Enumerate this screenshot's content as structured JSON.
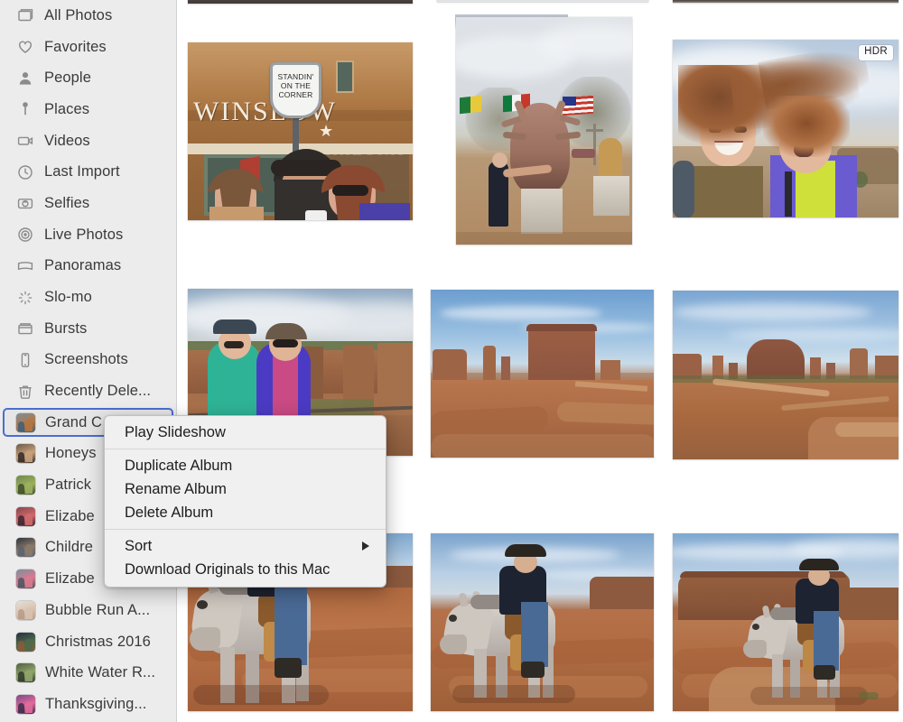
{
  "app": {
    "name": "Photos",
    "platform": "macOS"
  },
  "sidebar": {
    "background": "#ececec",
    "selection_border": "#4a6ed0",
    "smart_albums": [
      {
        "label": "All Photos",
        "icon": "all-photos-icon"
      },
      {
        "label": "Favorites",
        "icon": "heart-icon"
      },
      {
        "label": "People",
        "icon": "person-icon"
      },
      {
        "label": "Places",
        "icon": "map-pin-icon"
      },
      {
        "label": "Videos",
        "icon": "video-camera-icon"
      },
      {
        "label": "Last Import",
        "icon": "clock-icon"
      },
      {
        "label": "Selfies",
        "icon": "camera-icon"
      },
      {
        "label": "Live Photos",
        "icon": "live-photo-icon"
      },
      {
        "label": "Panoramas",
        "icon": "panorama-icon"
      },
      {
        "label": "Slo-mo",
        "icon": "slomo-icon"
      },
      {
        "label": "Bursts",
        "icon": "bursts-icon"
      },
      {
        "label": "Screenshots",
        "icon": "phone-icon"
      },
      {
        "label": "Recently Dele...",
        "icon": "trash-icon"
      }
    ],
    "albums": [
      {
        "label": "Grand C",
        "thumb": "album-thumb-grand-canyon",
        "selected": true,
        "colors": [
          "#7a8fa3",
          "#b5763f",
          "#3c5f7a"
        ]
      },
      {
        "label": "Honeys",
        "thumb": "album-thumb-honeymoon",
        "selected": false,
        "colors": [
          "#6b5a4a",
          "#c8a07a",
          "#2f2a26"
        ]
      },
      {
        "label": "Patrick",
        "thumb": "album-thumb-patrick",
        "selected": false,
        "colors": [
          "#6f8a4a",
          "#9bb05e",
          "#3f4d28"
        ]
      },
      {
        "label": "Elizabe",
        "thumb": "album-thumb-elizabeth-1",
        "selected": false,
        "colors": [
          "#8a4450",
          "#cf6a6a",
          "#3a2430"
        ]
      },
      {
        "label": "Childre",
        "thumb": "album-thumb-children",
        "selected": false,
        "colors": [
          "#2e3440",
          "#8a7a68",
          "#5a6272"
        ]
      },
      {
        "label": "Elizabe",
        "thumb": "album-thumb-elizabeth-2",
        "selected": false,
        "colors": [
          "#7d8f9e",
          "#d97a8f",
          "#4a5560"
        ]
      },
      {
        "label": "Bubble Run A...",
        "thumb": "album-thumb-bubble-run",
        "selected": false,
        "colors": [
          "#e6ded6",
          "#d7c2b0",
          "#b79b86"
        ]
      },
      {
        "label": "Christmas 2016",
        "thumb": "album-thumb-christmas-2016",
        "selected": false,
        "colors": [
          "#243040",
          "#4f6a4a",
          "#8a5a3a"
        ]
      },
      {
        "label": "White Water R...",
        "thumb": "album-thumb-white-water",
        "selected": false,
        "colors": [
          "#52603f",
          "#8fa36c",
          "#2f3a28"
        ]
      },
      {
        "label": "Thanksgiving...",
        "thumb": "album-thumb-thanksgiving",
        "selected": false,
        "colors": [
          "#7a4a8a",
          "#e06a9a",
          "#3a2a4a"
        ]
      }
    ]
  },
  "context_menu": {
    "name": "album-context-menu",
    "target_album": "Grand C",
    "groups": [
      {
        "items": [
          {
            "label": "Play Slideshow",
            "submenu": false
          }
        ]
      },
      {
        "items": [
          {
            "label": "Duplicate Album",
            "submenu": false
          },
          {
            "label": "Rename Album",
            "submenu": false
          },
          {
            "label": "Delete Album",
            "submenu": false
          }
        ]
      },
      {
        "items": [
          {
            "label": "Sort",
            "submenu": true
          },
          {
            "label": "Download Originals to this Mac",
            "submenu": false
          }
        ]
      }
    ]
  },
  "grid": {
    "badge_hdr": "HDR",
    "photos": [
      {
        "name": "photo-winslow-arizona",
        "caption": "Three people in front of Standin' on the Corner mural, Winslow Arizona",
        "badge": null
      },
      {
        "name": "photo-dinosaur-statue",
        "caption": "Person posing with dinosaur statue and flags",
        "badge": null
      },
      {
        "name": "photo-windy-selfie",
        "caption": "Two people windblown selfie in the desert",
        "badge": "HDR"
      },
      {
        "name": "photo-canyon-overlook-couple",
        "caption": "Two women at canyon de chelly overlook",
        "badge": null
      },
      {
        "name": "photo-monument-valley-mittens",
        "caption": "Monument Valley mesa and buttes",
        "badge": null
      },
      {
        "name": "photo-monument-valley-wide",
        "caption": "Monument Valley wide panorama with buttes",
        "badge": null
      },
      {
        "name": "photo-horse-rider-closeup",
        "caption": "Rider on grey horse in red desert, close up",
        "badge": null
      },
      {
        "name": "photo-horse-rider-mid",
        "caption": "Rider on grey horse with butte behind",
        "badge": null
      },
      {
        "name": "photo-horse-rider-mesa",
        "caption": "Rider on grey horse below a large mesa",
        "badge": null
      }
    ]
  }
}
